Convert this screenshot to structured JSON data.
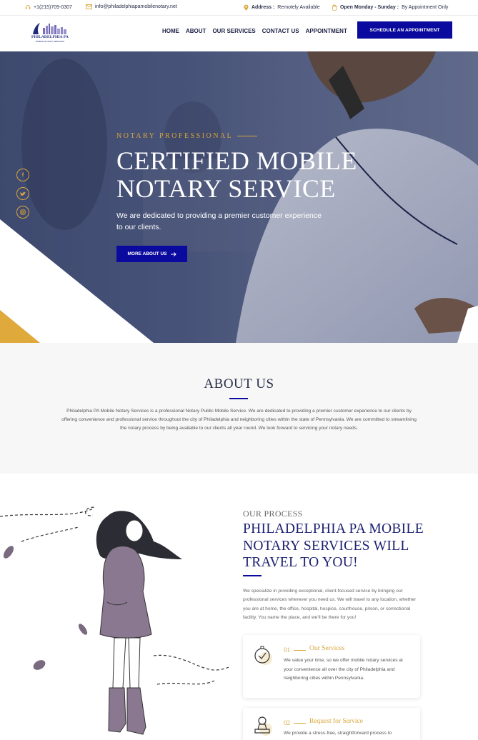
{
  "topbar": {
    "phone": "+1(215)709-0307",
    "email": "info@philadelphiapamobilenotary.net",
    "address_label": "Address :",
    "address_value": "Remotely Available",
    "hours_label": "Open Monday - Sunday :",
    "hours_value": "By Appointment Only"
  },
  "logo": {
    "name": "PHILADELPHIA PA",
    "tagline": "MOBILE NOTARY SERVICES"
  },
  "nav": {
    "home": "HOME",
    "about": "ABOUT",
    "services": "OUR SERVICES",
    "contact": "CONTACT US",
    "appointment": "APPOINTMENT"
  },
  "cta": {
    "label": "SCHEDULE AN APPOINTMENT"
  },
  "hero": {
    "eyebrow": "NOTARY PROFESSIONAL",
    "title": "CERTIFIED MOBILE NOTARY SERVICE",
    "text": "We are dedicated to providing a premier customer experience to our clients.",
    "button": "MORE ABOUT US",
    "social": [
      "facebook-icon",
      "twitter-icon",
      "instagram-icon"
    ]
  },
  "about": {
    "title": "ABOUT US",
    "text": "Philadelphia PA Mobile Notary Services is a professional Notary Public Mobile Service. We are dedicated to providing a premier customer experience to our clients by offering convenience and professional service throughout the city of Philadelphia and neighboring cities within the state of Pennsylvania. We are committed to streamlining the notary process by being available to our clients all year round. We look forward to servicing your notary needs."
  },
  "process": {
    "eyebrow": "OUR PROCESS",
    "title": "PHILADELPHIA PA MOBILE NOTARY SERVICES WILL TRAVEL TO YOU!",
    "text": "We specialize in providing exceptional, client-focused service by bringing our professional services wherever you need us. We will travel to any location, whether you are at home, the office, hospital, hospice, courthouse, prison, or correctional facility. You name the place, and we'll be there for you!",
    "steps": [
      {
        "num": "01",
        "title": "Our Services",
        "text": "We value your time, so we offer mobile notary services at your convenience all over the city of Philadelphia and neighboring cities within Pennsylvania."
      },
      {
        "num": "02",
        "title": "Request for Service",
        "text": "We provide a stress-free, straightforward process to"
      }
    ]
  },
  "colors": {
    "brand_blue": "#0a0a9e",
    "gold": "#d8a63c",
    "navy": "#1d2270"
  }
}
